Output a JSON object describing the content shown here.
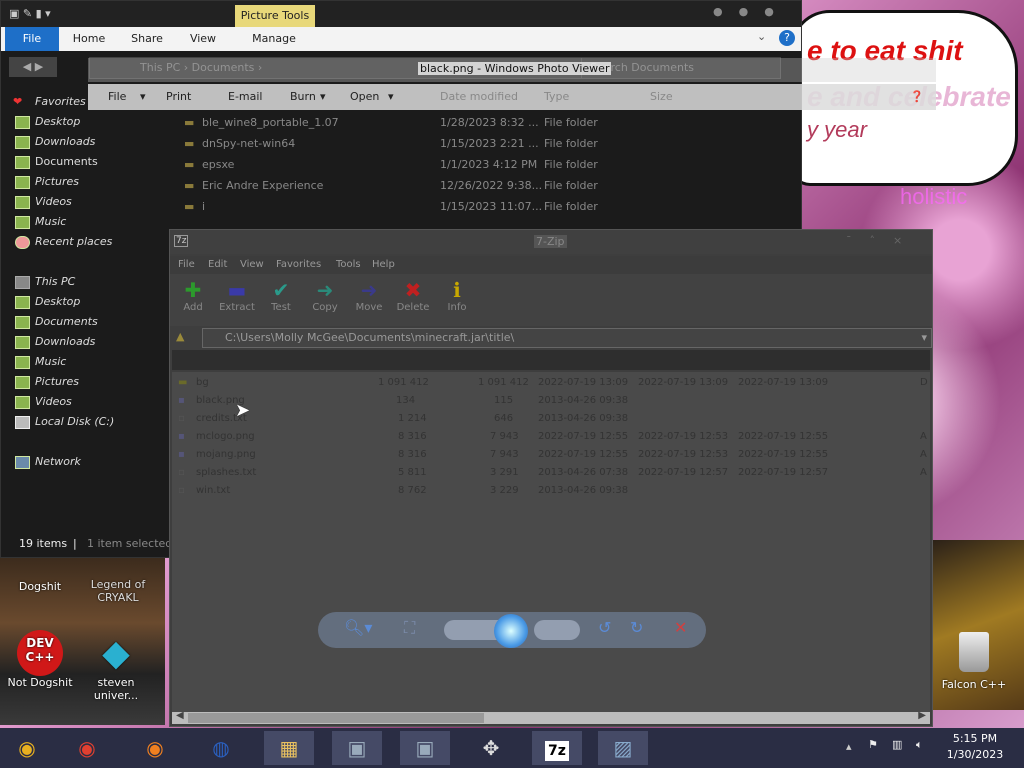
{
  "colors": {
    "accent": "#1e6fc8",
    "tools_tab": "#e8d87a",
    "taskbar": "#2a2d44"
  },
  "wallpaper": {
    "line1": "e to eat shit",
    "line2": "e and celebrate",
    "line3": "y year",
    "word": "holistic"
  },
  "explorer": {
    "ribbon_tabs": [
      "File",
      "Home",
      "Share",
      "View",
      "Manage"
    ],
    "picture_tools": "Picture Tools",
    "address": "This PC  ›  Documents  ›",
    "search_placeholder": "Search Documents",
    "nav": {
      "favorites_label": "Favorites",
      "favorites": [
        "Desktop",
        "Downloads",
        "Documents",
        "Pictures",
        "Videos",
        "Music",
        "Recent places"
      ],
      "thispc_label": "This PC",
      "thispc": [
        "Desktop",
        "Documents",
        "Downloads",
        "Music",
        "Pictures",
        "Videos",
        "Local Disk (C:)"
      ],
      "network": "Network"
    },
    "status_count": "19 items",
    "status_sel": "1 item selected",
    "columns": [
      "Date modified",
      "Type",
      "Size"
    ],
    "files": [
      {
        "name": "ble_wine8_portable_1.07",
        "date": "1/28/2023 8:32 ...",
        "type": "File folder"
      },
      {
        "name": "dnSpy-net-win64",
        "date": "1/15/2023 2:21 ...",
        "type": "File folder"
      },
      {
        "name": "epsxe",
        "date": "1/1/2023 4:12 PM",
        "type": "File folder"
      },
      {
        "name": "Eric Andre Experience",
        "date": "12/26/2022 9:38...",
        "type": "File folder"
      },
      {
        "name": "i",
        "date": "1/15/2023 11:07...",
        "type": "File folder"
      }
    ]
  },
  "photoviewer": {
    "title": "black.png - Windows Photo Viewer",
    "menu": [
      "File",
      "Print",
      "E-mail",
      "Burn",
      "Open"
    ]
  },
  "sevenzip": {
    "title": "7-Zip",
    "badge": "7z",
    "menu": [
      "File",
      "Edit",
      "View",
      "Favorites",
      "Tools",
      "Help"
    ],
    "tools": [
      {
        "label": "Add",
        "glyph": "✚",
        "color": "#2c9a2c"
      },
      {
        "label": "Extract",
        "glyph": "▬",
        "color": "#3a3aa8"
      },
      {
        "label": "Test",
        "glyph": "✔",
        "color": "#2a9a8a"
      },
      {
        "label": "Copy",
        "glyph": "➜",
        "color": "#2a8a7a"
      },
      {
        "label": "Move",
        "glyph": "➜",
        "color": "#3a3a8a"
      },
      {
        "label": "Delete",
        "glyph": "✖",
        "color": "#c02020"
      },
      {
        "label": "Info",
        "glyph": "ℹ",
        "color": "#c8a800"
      }
    ],
    "path": "C:\\Users\\Molly McGee\\Documents\\minecraft.jar\\title\\",
    "rows": [
      {
        "name": "bg",
        "size": "1 091 412",
        "packed": "1 091 412",
        "modified": "2022-07-19 13:09",
        "created": "2022-07-19 13:09",
        "accessed": "2022-07-19 13:09",
        "attr": "D"
      },
      {
        "name": "black.png",
        "size": "134",
        "packed": "115",
        "modified": "2013-04-26 09:38",
        "created": "",
        "accessed": "",
        "attr": ""
      },
      {
        "name": "credits.txt",
        "size": "1 214",
        "packed": "646",
        "modified": "2013-04-26 09:38",
        "created": "",
        "accessed": "",
        "attr": ""
      },
      {
        "name": "mclogo.png",
        "size": "8 316",
        "packed": "7 943",
        "modified": "2022-07-19 12:55",
        "created": "2022-07-19 12:53",
        "accessed": "2022-07-19 12:55",
        "attr": "A"
      },
      {
        "name": "mojang.png",
        "size": "8 316",
        "packed": "7 943",
        "modified": "2022-07-19 12:55",
        "created": "2022-07-19 12:53",
        "accessed": "2022-07-19 12:55",
        "attr": "A"
      },
      {
        "name": "splashes.txt",
        "size": "5 811",
        "packed": "3 291",
        "modified": "2013-04-26 07:38",
        "created": "2022-07-19 12:57",
        "accessed": "2022-07-19 12:57",
        "attr": "A"
      },
      {
        "name": "win.txt",
        "size": "8 762",
        "packed": "3 229",
        "modified": "2013-04-26 09:38",
        "created": "",
        "accessed": "",
        "attr": ""
      }
    ]
  },
  "desktop_icons": [
    {
      "label": "Dogshit",
      "icon": "folder-icon"
    },
    {
      "label": "Legend of CRYAKL",
      "icon": "folder-icon"
    },
    {
      "label": "Not Dogshit",
      "icon": "dev-cpp-icon",
      "badge": "DEV C++"
    },
    {
      "label": "steven univer...",
      "icon": "gem-icon"
    },
    {
      "label": "Falcon C++",
      "icon": "recycle-bin-icon"
    }
  ],
  "taskbar": {
    "apps": [
      "chrome-ie-icon",
      "chrome-icon",
      "firefox-icon",
      "obama-icon",
      "explorer-icon",
      "pc-app-icon",
      "pc-app-icon-2",
      "gamepad-icon",
      "7z-icon",
      "photo-viewer-icon"
    ],
    "sevenz_label": "7z",
    "time": "5:15 PM",
    "date": "1/30/2023"
  }
}
